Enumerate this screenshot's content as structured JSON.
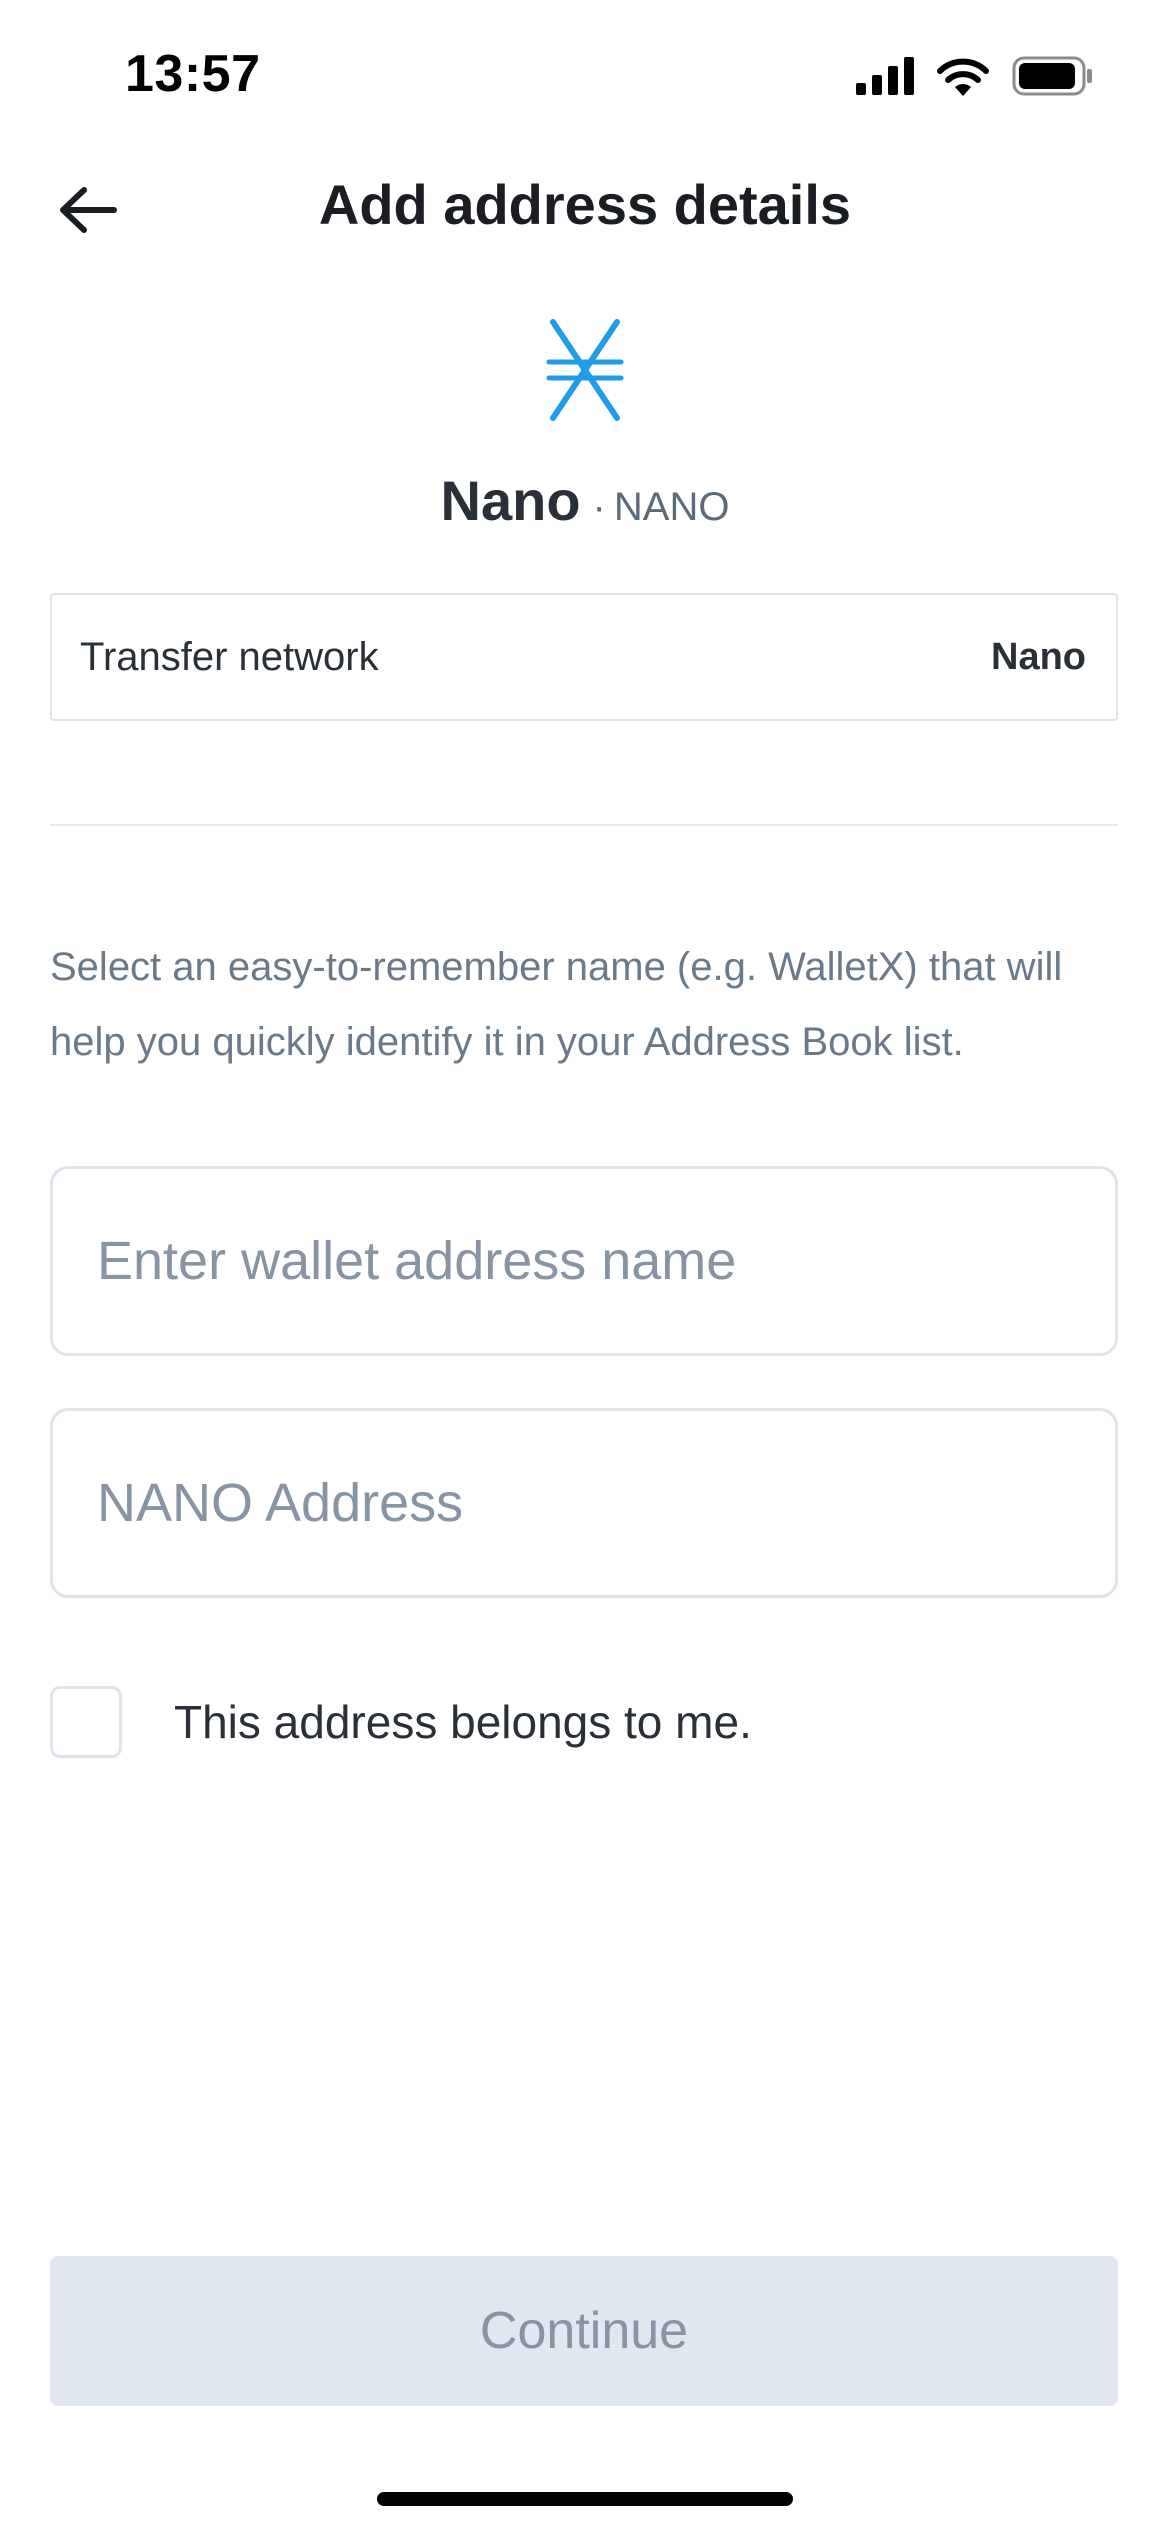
{
  "status_bar": {
    "time": "13:57",
    "icons": [
      "cellular-signal-icon",
      "wifi-icon",
      "battery-icon"
    ]
  },
  "header": {
    "title": "Add address details",
    "back_icon": "arrow-left-icon"
  },
  "coin": {
    "name": "Nano",
    "separator": "·",
    "symbol": "NANO",
    "icon": "nano-logo-icon",
    "brand_color": "#209CE9"
  },
  "network": {
    "label": "Transfer network",
    "value": "Nano"
  },
  "form": {
    "helper_text": "Select an easy-to-remember name (e.g. WalletX) that will help you quickly identify it in your Address Book list.",
    "name_input": {
      "value": "",
      "placeholder": "Enter wallet address name"
    },
    "address_input": {
      "value": "",
      "placeholder": "NANO Address"
    },
    "ownership_checkbox": {
      "label": "This address belongs to me.",
      "checked": false
    }
  },
  "continue_button": {
    "label": "Continue",
    "enabled": false
  },
  "colors": {
    "text_primary": "#1A1D21",
    "text_secondary": "#6B7A89",
    "border": "#DDE4EC",
    "button_disabled_bg": "#E0E7EE",
    "button_disabled_text": "#8694A3"
  }
}
